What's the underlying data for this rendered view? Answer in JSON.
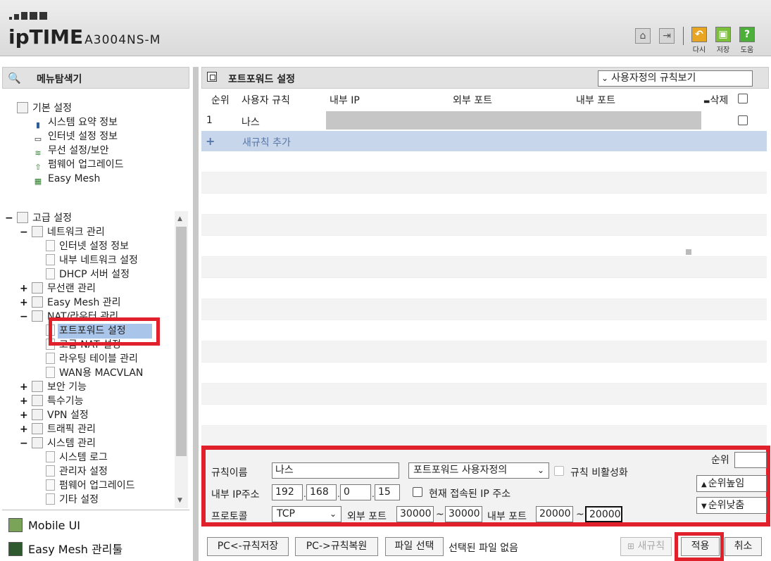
{
  "header": {
    "logo_text": "ipTIME",
    "model": "A3004NS-M",
    "actions": [
      {
        "label": "다시",
        "icon": "undo-icon",
        "color": "#e7a522"
      },
      {
        "label": "저장",
        "icon": "save-icon",
        "color": "#7cbf3a"
      },
      {
        "label": "도움",
        "icon": "help-icon",
        "color": "#4caf3a",
        "glyph": "?"
      }
    ]
  },
  "nav": {
    "title": "메뉴탐색기",
    "basic": {
      "label": "기본 설정",
      "items": [
        "시스템 요약 정보",
        "인터넷 설정 정보",
        "무선 설정/보안",
        "펌웨어 업그레이드",
        "Easy Mesh"
      ]
    },
    "advanced": {
      "label": "고급 설정",
      "network": {
        "label": "네트워크 관리",
        "items": [
          "인터넷 설정 정보",
          "내부 네트워크 설정",
          "DHCP 서버 설정"
        ]
      },
      "groups": [
        "무선랜 관리",
        "Easy Mesh 관리"
      ],
      "nat": {
        "label": "NAT/라우터 관리",
        "items": [
          "포트포워드 설정",
          "고급 NAT 설정",
          "라우팅 테이블 관리",
          "WAN용 MACVLAN"
        ]
      },
      "groups2": [
        "보안 기능",
        "특수기능",
        "VPN 설정",
        "트래픽 관리"
      ],
      "system": {
        "label": "시스템 관리",
        "items": [
          "시스템 로그",
          "관리자 설정",
          "펌웨어 업그레이드",
          "기타 설정"
        ]
      }
    },
    "bottom_links": [
      "Mobile UI",
      "Easy Mesh 관리툴"
    ]
  },
  "main": {
    "title": "포트포워드 설정",
    "view_select": "사용자정의 규칙보기",
    "columns": [
      "순위",
      "사용자 규칙",
      "내부 IP",
      "외부 포트",
      "내부 포트",
      "삭제"
    ],
    "rows": [
      {
        "rank": "1",
        "name": "나스"
      }
    ],
    "add_rule": "새규칙 추가"
  },
  "form": {
    "rule_name_label": "규칙이름",
    "rule_name": "나스",
    "rule_type": "포트포워드 사용자정의",
    "disable_label": "규칙 비활성화",
    "rank_label": "순위",
    "rank_value": "",
    "ip_label": "내부 IP주소",
    "ip": [
      "192",
      "168",
      "0",
      "15"
    ],
    "current_ip_label": "현재 접속된 IP 주소",
    "rank_up": "순위높임",
    "rank_down": "순위낮춤",
    "protocol_label": "프로토콜",
    "protocol": "TCP",
    "ext_port_label": "외부 포트",
    "ext_port_from": "30000",
    "ext_port_to": "30000",
    "int_port_label": "내부 포트",
    "int_port_from": "20000",
    "int_port_to": "20000",
    "tilde": "~"
  },
  "footer": {
    "save_to_pc": "PC<-규칙저장",
    "restore_from_pc": "PC->규칙복원",
    "choose_file": "파일 선택",
    "no_file": "선택된 파일 없음",
    "new_rule": "새규칙",
    "apply": "적용",
    "cancel": "취소"
  },
  "colors": {
    "highlight": "#e0202a",
    "selected": "#a9c6ea",
    "add_row": "#c7d6ea"
  }
}
